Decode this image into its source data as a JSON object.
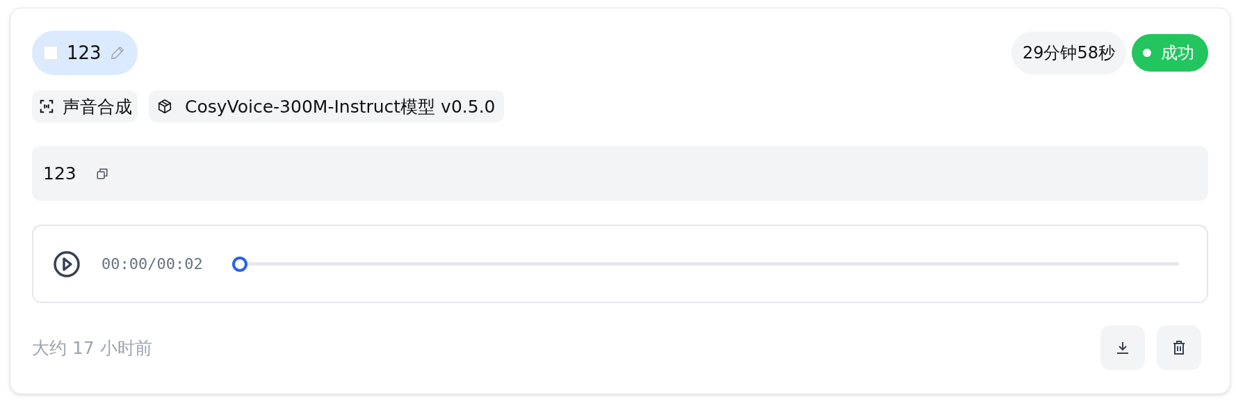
{
  "task": {
    "title": "123",
    "checked": false,
    "duration": "29分钟58秒",
    "status": {
      "label": "成功",
      "kind": "success"
    },
    "tags": [
      {
        "kind": "task",
        "label": "声音合成"
      },
      {
        "kind": "model",
        "label": "CosyVoice-300M-Instruct模型 v0.5.0"
      }
    ],
    "text": "123",
    "player": {
      "time": "00:00/00:02",
      "level": 0
    },
    "created": "大约 17 小时前"
  }
}
